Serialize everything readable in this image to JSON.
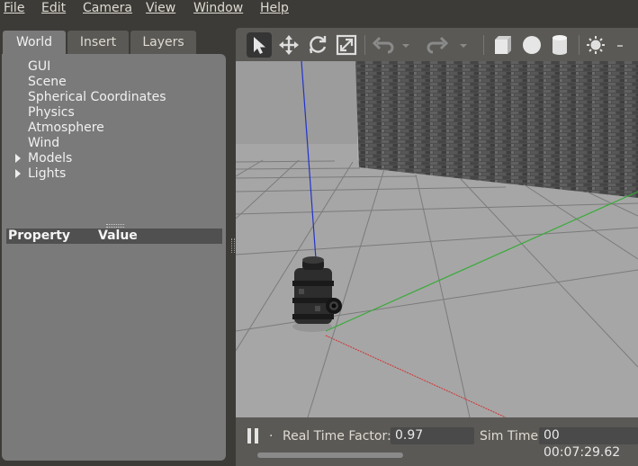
{
  "menubar": {
    "items": [
      "File",
      "Edit",
      "Camera",
      "View",
      "Window",
      "Help"
    ]
  },
  "left_panel": {
    "tabs": [
      "World",
      "Insert",
      "Layers"
    ],
    "tree": [
      "GUI",
      "Scene",
      "Spherical Coordinates",
      "Physics",
      "Atmosphere",
      "Wind",
      "Models",
      "Lights"
    ],
    "property_header": {
      "property": "Property",
      "value": "Value"
    }
  },
  "toolbar": {
    "tools": [
      "select-arrow-icon",
      "translate-icon",
      "rotate-icon",
      "scale-icon",
      "undo-icon",
      "redo-icon",
      "box-icon",
      "sphere-icon",
      "cylinder-icon",
      "sun-icon"
    ]
  },
  "statusbar": {
    "pause_icon": "pause-icon",
    "dot": ".",
    "real_time_factor_label": "Real Time Factor:",
    "real_time_factor_value": "0.97",
    "sim_time_label": "Sim Time:",
    "sim_time_value": "00 00:07:29.62"
  },
  "colors": {
    "background": "#3c3b37",
    "panel": "#7a7a7a",
    "scene_sky": "#b1b1b1",
    "scene_ground": "#a6a6a6",
    "axis_x": "#d53030",
    "axis_y": "#3aaa3a",
    "axis_z": "#2233cc"
  }
}
